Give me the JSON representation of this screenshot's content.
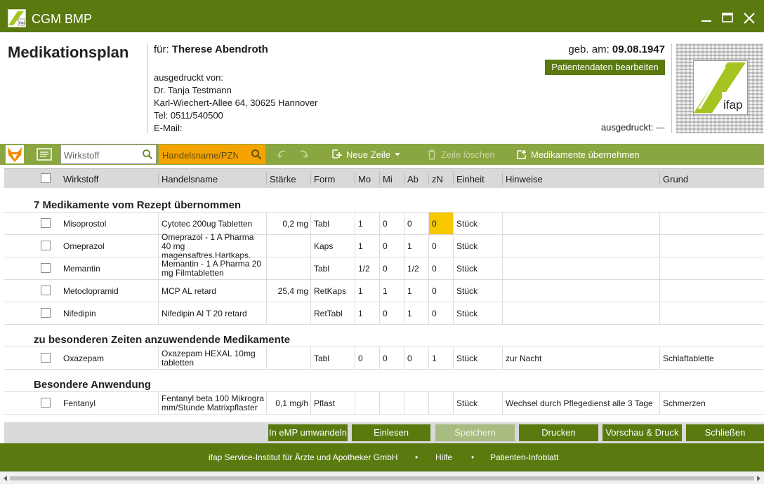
{
  "window": {
    "title": "CGM BMP"
  },
  "header": {
    "page_title": "Medikationsplan",
    "fuer_label": "für:",
    "patient_name": "Therese Abendroth",
    "printed_by_label": "ausgedruckt von:",
    "doctor": "Dr. Tanja Testmann",
    "address": "Karl-Wiechert-Allee 64, 30625 Hannover",
    "tel": "Tel: 0511/540500",
    "email": "E-Mail:",
    "birth_label": "geb. am:",
    "birth_date": "09.08.1947",
    "edit_button": "Patientendaten bearbeiten",
    "printed_status": "ausgedruckt: ---",
    "logo_text": "ifap"
  },
  "toolbar": {
    "search_wirkstoff_placeholder": "Wirkstoff",
    "search_handelsname_placeholder": "Handelsname/PZN",
    "new_row": "Neue Zeile",
    "delete_row": "Zeile löschen",
    "take_over": "Medikamente übernehmen"
  },
  "columns": {
    "wirkstoff": "Wirkstoff",
    "handelsname": "Handelsname",
    "staerke": "Stärke",
    "form": "Form",
    "mo": "Mo",
    "mi": "Mi",
    "ab": "Ab",
    "zn": "zN",
    "einheit": "Einheit",
    "hinweise": "Hinweise",
    "grund": "Grund"
  },
  "sections": [
    {
      "title": "7 Medikamente vom Rezept übernommen",
      "rows": [
        {
          "wirkstoff": "Misoprostol",
          "handelsname": "Cytotec 200ug Tabletten",
          "staerke": "0,2 mg",
          "form": "Tabl",
          "mo": "1",
          "mi": "0",
          "ab": "0",
          "zn": "0",
          "einheit": "Stück",
          "hinweise": "",
          "grund": ""
        },
        {
          "wirkstoff": "Omeprazol",
          "handelsname": "Omeprazol - 1 A Pharma 40 mg magensaftres.Hartkaps.",
          "staerke": "",
          "form": "Kaps",
          "mo": "1",
          "mi": "0",
          "ab": "1",
          "zn": "0",
          "einheit": "Stück",
          "hinweise": "",
          "grund": ""
        },
        {
          "wirkstoff": "Memantin",
          "handelsname": "Memantin - 1 A Pharma 20 mg Filmtabletten",
          "staerke": "",
          "form": "Tabl",
          "mo": "1/2",
          "mi": "0",
          "ab": "1/2",
          "zn": "0",
          "einheit": "Stück",
          "hinweise": "",
          "grund": ""
        },
        {
          "wirkstoff": "Metoclopramid",
          "handelsname": "MCP AL retard",
          "staerke": "25,4 mg",
          "form": "RetKaps",
          "mo": "1",
          "mi": "1",
          "ab": "1",
          "zn": "0",
          "einheit": "Stück",
          "hinweise": "",
          "grund": ""
        },
        {
          "wirkstoff": "Nifedipin",
          "handelsname": "Nifedipin Al T 20 retard",
          "staerke": "",
          "form": "RetTabl",
          "mo": "1",
          "mi": "0",
          "ab": "1",
          "zn": "0",
          "einheit": "Stück",
          "hinweise": "",
          "grund": ""
        }
      ]
    },
    {
      "title": "zu besonderen Zeiten anzuwendende Medikamente",
      "rows": [
        {
          "wirkstoff": "Oxazepam",
          "handelsname": "Oxazepam HEXAL 10mg tabletten",
          "staerke": "",
          "form": "Tabl",
          "mo": "0",
          "mi": "0",
          "ab": "0",
          "zn": "1",
          "einheit": "Stück",
          "hinweise": "zur Nacht",
          "grund": "Schlaftablette"
        }
      ]
    },
    {
      "title": "Besondere Anwendung",
      "rows": [
        {
          "wirkstoff": "Fentanyl",
          "handelsname": "Fentanyl beta 100 Mikrogra mm/Stunde Matrixpflaster",
          "staerke": "0,1 mg/h",
          "form": "Pflast",
          "mo": "",
          "mi": "",
          "ab": "",
          "zn": "",
          "einheit": "Stück",
          "hinweise": "Wechsel durch Pflegedienst alle 3 Tage",
          "grund": "Schmerzen"
        }
      ]
    }
  ],
  "actions": {
    "emp": "In eMP umwandeln",
    "einlesen": "Einlesen",
    "speichern": "Speichern",
    "drucken": "Drucken",
    "vorschau": "Vorschau & Druck",
    "schliessen": "Schließen"
  },
  "footer": {
    "institute": "ifap Service-Institut für Ärzte und Apotheker GmbH",
    "dot1": "•",
    "hilfe": "Hilfe",
    "dot2": "•",
    "infoblatt": "Patienten-Infoblatt"
  },
  "colors": {
    "brand_green": "#5a7a10",
    "toolbar_green": "#8aa640",
    "highlight_orange": "#f5a300",
    "cell_highlight_yellow": "#f5c800"
  }
}
